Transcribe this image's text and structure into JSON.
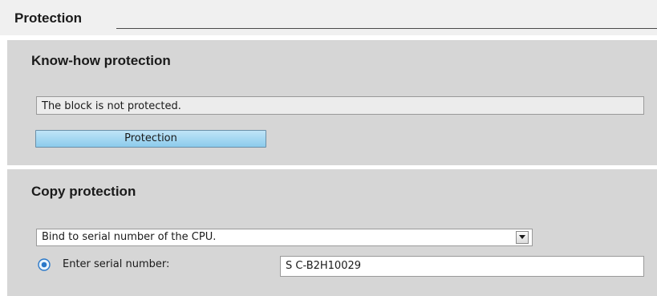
{
  "section": {
    "title": "Protection"
  },
  "knowhow": {
    "title": "Know-how protection",
    "status_text": "The block is not protected.",
    "button_label": "Protection"
  },
  "copy": {
    "title": "Copy protection",
    "select_value": "Bind to serial number of the CPU.",
    "radio_label": "Enter serial number:",
    "radio_selected": true,
    "serial_value": "S C-B2H10029"
  },
  "icons": {
    "dropdown": "chevron-down-icon",
    "radio": "radio-selected-icon"
  },
  "colors": {
    "button_top": "#bfe4f7",
    "button_bottom": "#8ccbec",
    "group_bg": "#d6d6d6",
    "radio_accent": "#2a78c9"
  }
}
